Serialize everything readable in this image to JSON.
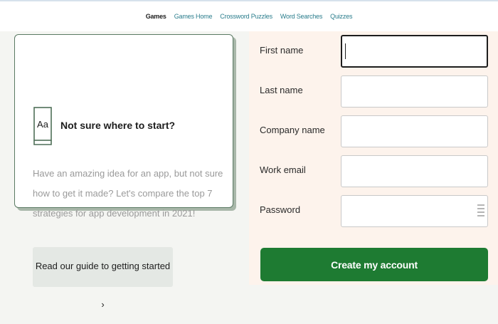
{
  "nav": {
    "items": [
      {
        "label": "Games",
        "active": true
      },
      {
        "label": "Games Home",
        "active": false
      },
      {
        "label": "Crossword Puzzles",
        "active": false
      },
      {
        "label": "Word Searches",
        "active": false
      },
      {
        "label": "Quizzes",
        "active": false
      }
    ]
  },
  "card": {
    "icon": "book-icon",
    "icon_text": "Aa",
    "title": "Not sure where to start?",
    "body": "Have an amazing idea for an app, but not sure how to get it made? Let's compare the top 7 strategies for app development in 2021!",
    "cta": "Read our guide to getting started ›"
  },
  "form": {
    "fields": [
      {
        "label": "First name",
        "value": ""
      },
      {
        "label": "Last name",
        "value": ""
      },
      {
        "label": "Company name",
        "value": ""
      },
      {
        "label": "Work email",
        "value": ""
      },
      {
        "label": "Password",
        "value": ""
      }
    ],
    "password_icon": "password-manager-icon",
    "submit": "Create my account"
  },
  "colors": {
    "brand_green": "#1e7b32",
    "link_teal": "#2a7d8c",
    "form_bg": "#fdf3ec",
    "card_border": "#5a7a63"
  }
}
